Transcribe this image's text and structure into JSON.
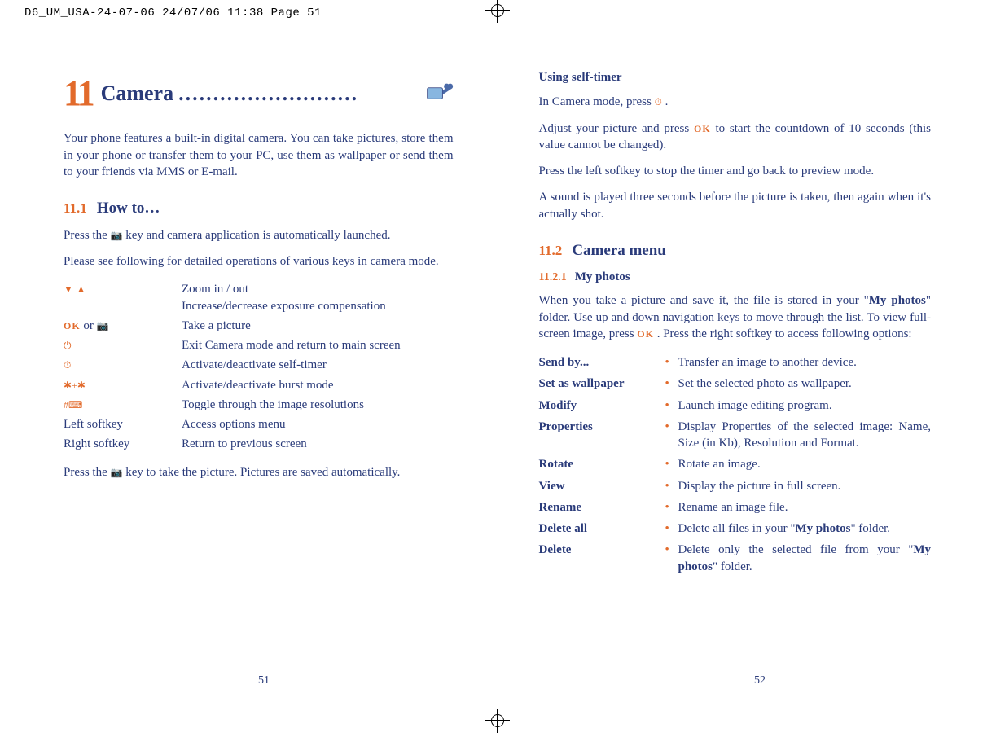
{
  "meta_line": "D6_UM_USA-24-07-06  24/07/06  11:38  Page 51",
  "chapter": {
    "num": "11",
    "title": "Camera"
  },
  "intro": "Your phone features a built-in digital camera. You can take pictures, store them in your phone or transfer them to your PC, use them as wallpaper or send them to your friends via MMS or E-mail.",
  "sec11_1": {
    "num": "11.1",
    "title": "How to…"
  },
  "p_press_cam_1": "Press the ",
  "p_press_cam_2": " key and camera application is automatically launched.",
  "p_detailed": "Please see following for detailed operations of various keys in camera mode.",
  "keys": [
    {
      "desc_a": "Zoom in / out",
      "desc_b": "Increase/decrease exposure compensation"
    },
    {
      "desc_a": "Take a picture"
    },
    {
      "desc_a": "Exit Camera mode and return to main screen"
    },
    {
      "desc_a": "Activate/deactivate self-timer"
    },
    {
      "desc_a": "Activate/deactivate burst mode"
    },
    {
      "desc_a": "Toggle through the image resolutions"
    },
    {
      "label": "Left softkey",
      "desc_a": "Access options menu"
    },
    {
      "label": "Right softkey",
      "desc_a": "Return to previous screen"
    }
  ],
  "key_or": " or ",
  "p_take_pic_1": "Press the ",
  "p_take_pic_2": " key to take the picture. Pictures are saved automatically.",
  "selftimer": {
    "head": "Using self-timer",
    "p1a": "In Camera mode, press ",
    "p1b": " .",
    "p2a": "Adjust your picture and press ",
    "p2b": " to start the countdown of 10 seconds (this value cannot be changed).",
    "p3": "Press the left softkey to stop the timer and go back to preview mode.",
    "p4": "A sound is played three seconds before the picture is taken, then again when it's actually shot."
  },
  "sec11_2": {
    "num": "11.2",
    "title": "Camera menu"
  },
  "sub11_2_1": {
    "num": "11.2.1",
    "title": "My photos"
  },
  "myphotos_p_a": "When you take a picture and save it, the file is stored in your \"",
  "myphotos_bold1": "My photos",
  "myphotos_p_b": "\" folder. Use up and down navigation keys to move through the list. To view full-screen image, press ",
  "myphotos_p_c": " . Press the right softkey to access following options:",
  "options": [
    {
      "l": "Send by...",
      "r": "Transfer an image to another device."
    },
    {
      "l": "Set as wallpaper",
      "r": "Set the selected photo as wallpaper."
    },
    {
      "l": "Modify",
      "r": "Launch image editing program."
    },
    {
      "l": "Properties",
      "r": "Display Properties of the selected image: Name, Size (in Kb), Resolution and Format."
    },
    {
      "l": "Rotate",
      "r": "Rotate an image."
    },
    {
      "l": "View",
      "r": "Display the picture in full screen."
    },
    {
      "l": "Rename",
      "r": "Rename an image file."
    }
  ],
  "opt_delete_all": {
    "l": "Delete all",
    "r_a": "Delete all files in your \"",
    "bold": "My photos",
    "r_b": "\" folder."
  },
  "opt_delete": {
    "l": "Delete",
    "r_a": "Delete only the selected file from your \"",
    "bold": "My photos",
    "r_b": "\" folder."
  },
  "page_left": "51",
  "page_right": "52"
}
